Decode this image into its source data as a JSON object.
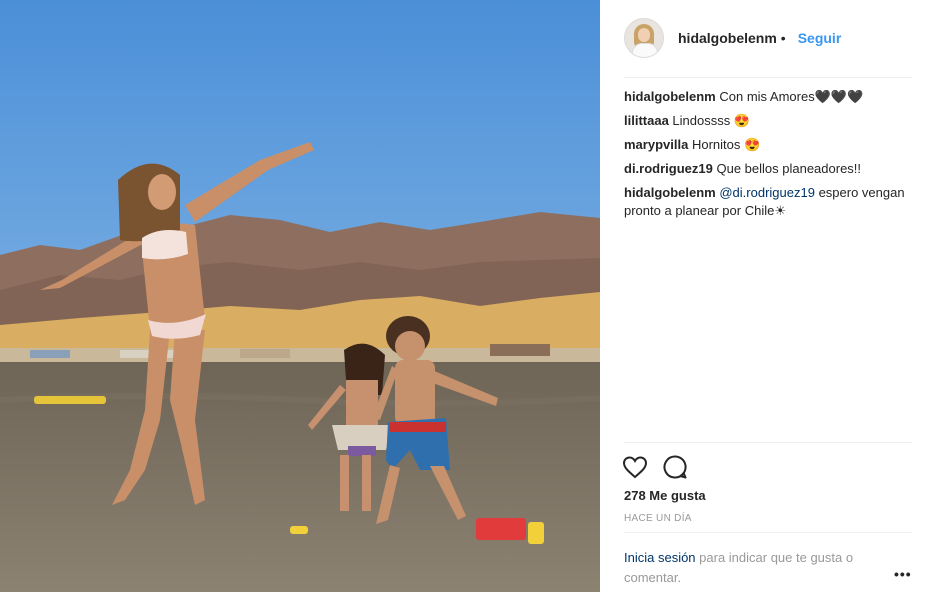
{
  "post": {
    "image_description_icon": "beach-photo",
    "author": "hidalgobelenm",
    "separator_dot": "•",
    "follow_label": "Seguir"
  },
  "comments": [
    {
      "user": "hidalgobelenm",
      "text": "Con mis Amores🖤🖤🖤"
    },
    {
      "user": "lilittaaa",
      "text": "Lindossss 😍"
    },
    {
      "user": "marypvilla",
      "text": "Hornitos 😍"
    },
    {
      "user": "di.rodriguez19",
      "text": "Que bellos planeadores!!"
    },
    {
      "user": "hidalgobelenm",
      "mention": "@di.rodriguez19",
      "text": " espero vengan pronto a planear por Chile☀"
    }
  ],
  "actions": {
    "like_icon": "heart-icon",
    "comment_icon": "comment-icon"
  },
  "likes_text": "278 Me gusta",
  "time_text": "HACE UN DÍA",
  "login": {
    "link": "Inicia sesión",
    "text": " para indicar que te gusta o comentar."
  },
  "more_label": "•••",
  "colors": {
    "follow": "#3897f0",
    "mention": "#003569",
    "muted": "#999999"
  }
}
